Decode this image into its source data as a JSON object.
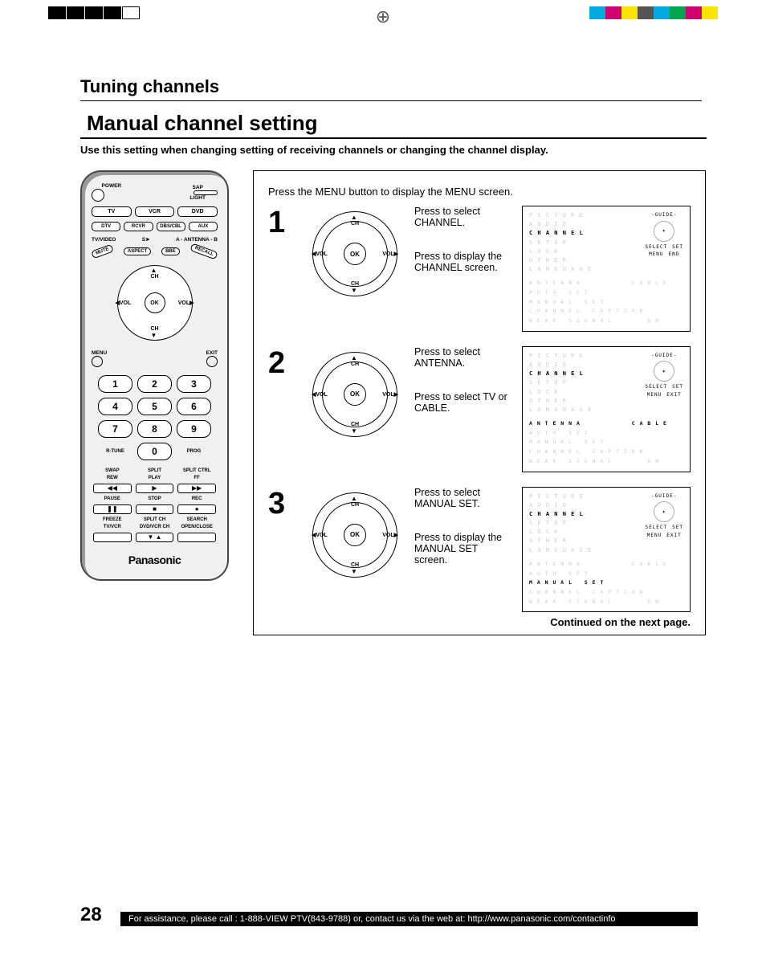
{
  "page_number": "28",
  "section_title": "Tuning channels",
  "subtitle": "Manual channel setting",
  "intro": "Use this setting when changing setting of receiving channels or changing the channel display.",
  "remote": {
    "power": "POWER",
    "sap": "SAP",
    "light": "LIGHT",
    "row1": [
      "TV",
      "VCR",
      "DVD"
    ],
    "row2": [
      "DTV",
      "RCVR",
      "DBS/CBL",
      "AUX"
    ],
    "tvvideo": "TV/VIDEO",
    "antenna": "A - ANTENNA - B",
    "curve": [
      "MUTE",
      "ASPECT",
      "BBE",
      "RECALL"
    ],
    "dpad": {
      "ok": "OK",
      "up": "CH",
      "down": "CH",
      "left": "VOL",
      "right": "VOL"
    },
    "menu": "MENU",
    "exit": "EXIT",
    "numbers": [
      "1",
      "2",
      "3",
      "4",
      "5",
      "6",
      "7",
      "8",
      "9",
      "0"
    ],
    "rtune": "R-TUNE",
    "prog": "PROG",
    "transport_labels": [
      "SWAP",
      "SPLIT",
      "SPLIT CTRL",
      "REW",
      "PLAY",
      "FF",
      "PAUSE",
      "STOP",
      "REC",
      "FREEZE",
      "SPLIT CH",
      "SEARCH",
      "TV/VCR",
      "DVD/VCR CH",
      "OPEN/CLOSE"
    ],
    "brand": "Panasonic"
  },
  "steps_intro": "Press the MENU button to display the MENU screen.",
  "steps": [
    {
      "num": "1",
      "text1": "Press to select CHANNEL.",
      "text2": "Press to display the CHANNEL screen.",
      "menu_items": [
        "PICTURE",
        "AUDIO",
        "CHANNEL",
        "SETUP",
        "LOCK",
        "OTHER",
        "LANGUAGE"
      ],
      "menu_selected": "CHANNEL",
      "guide_title": "-GUIDE-",
      "guide_r1": "SELECT",
      "guide_r2": "SET",
      "guide_r3": "MENU",
      "guide_r4": "END",
      "sub_items": [
        "ANTENNA      CABLE",
        "AUTO SET",
        "MANUAL SET",
        "CHANNEL CAPTION",
        "WEAK SIGNAL    ON"
      ],
      "sub_selected": ""
    },
    {
      "num": "2",
      "text1": "Press to select ANTENNA.",
      "text2": "Press to select TV or CABLE.",
      "menu_items": [
        "PICTURE",
        "AUDIO",
        "CHANNEL",
        "SETUP",
        "LOCK",
        "OTHER",
        "LANGUAGE"
      ],
      "menu_selected": "CHANNEL",
      "guide_title": "-GUIDE-",
      "guide_r1": "SELECT",
      "guide_r2": "SET",
      "guide_r3": "MENU",
      "guide_r4": "EXIT",
      "sub_items": [
        "ANTENNA      CABLE",
        "AUTO SET",
        "MANUAL SET",
        "CHANNEL CAPTION",
        "WEAK SIGNAL    ON"
      ],
      "sub_selected": "ANTENNA      CABLE"
    },
    {
      "num": "3",
      "text1": "Press to select MANUAL SET.",
      "text2": "Press to display the MANUAL SET screen.",
      "menu_items": [
        "PICTURE",
        "AUDIO",
        "CHANNEL",
        "SETUP",
        "LOCK",
        "OTHER",
        "LANGUAGE"
      ],
      "menu_selected": "CHANNEL",
      "guide_title": "-GUIDE-",
      "guide_r1": "SELECT",
      "guide_r2": "SET",
      "guide_r3": "MENU",
      "guide_r4": "EXIT",
      "sub_items": [
        "ANTENNA      CABLE",
        "AUTO SET",
        "MANUAL SET",
        "CHANNEL CAPTION",
        "WEAK SIGNAL    ON"
      ],
      "sub_selected": "MANUAL SET"
    }
  ],
  "continued": "Continued on the next page.",
  "footer": "For assistance, please call : 1-888-VIEW PTV(843-9788) or, contact us via the web at: http://www.panasonic.com/contactinfo",
  "colorbar_right": [
    "#00a9e0",
    "#d0006f",
    "#ffe600",
    "#555",
    "#00a9e0",
    "#00a550",
    "#d0006f",
    "#ffe600"
  ]
}
